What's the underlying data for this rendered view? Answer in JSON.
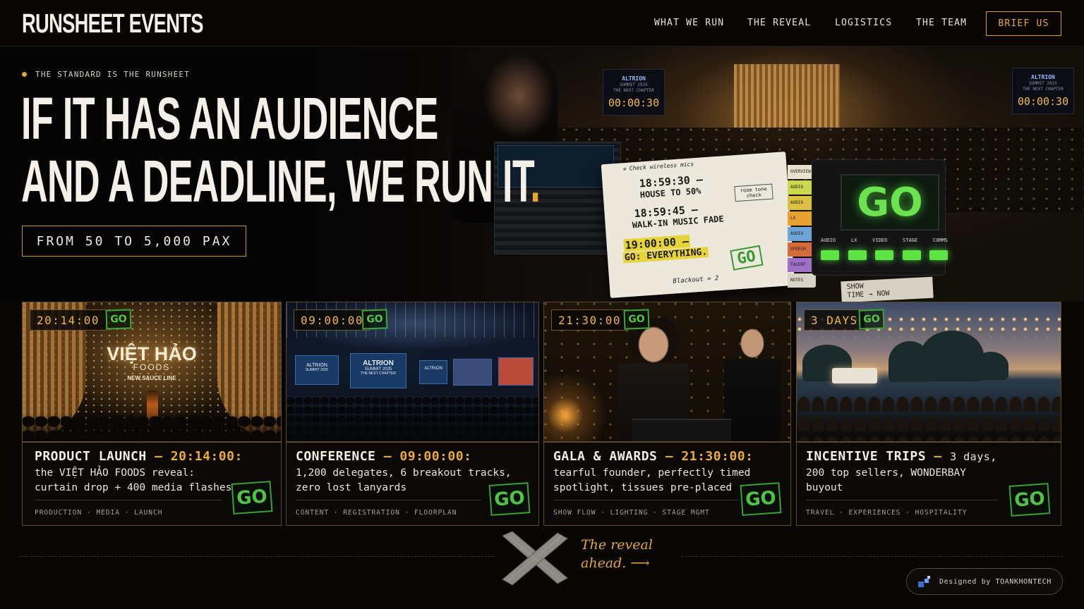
{
  "brand": "RUNSHEET EVENTS",
  "nav": {
    "links": [
      "WHAT WE RUN",
      "THE REVEAL",
      "LOGISTICS",
      "THE TEAM"
    ],
    "cta": "BRIEF US"
  },
  "hero": {
    "eyebrow": "THE STANDARD IS THE RUNSHEET",
    "headline_line1": "IF IT HAS AN AUDIENCE",
    "headline_line2": "AND A DEADLINE, WE RUN IT",
    "headline_dot": ".",
    "pax": "FROM 50 TO 5,000 PAX",
    "monitors": [
      {
        "brand": "ALTRION",
        "sub1": "SUMMIT 2025",
        "sub2": "THE NEXT CHAPTER",
        "time": "00:00:30"
      },
      {
        "brand": "ALTRION",
        "sub1": "SUMMIT 2025",
        "sub2": "THE NEXT CHAPTER",
        "time": "00:00:30"
      }
    ],
    "runsheet": {
      "note_top": "✲ Check wireless mics",
      "line1_time": "18:59:30 —",
      "line1_text": "HOUSE TO 50%",
      "line2_time": "18:59:45 —",
      "line2_text": "WALK-IN MUSIC FADE",
      "line3_time": "19:00:00 —",
      "line3_text": "GO: EVERYTHING.",
      "sticky": "room tone check",
      "footer_note": "Blackout = 2",
      "stamp": "GO",
      "tabs": [
        "OVERVIEW",
        "AUDIO",
        "AUDIO",
        "LX",
        "AUDIO",
        "SPEECH",
        "TALENT",
        "NOTES"
      ]
    },
    "go_panel": {
      "screen": "GO",
      "labels": [
        "AUDIO",
        "LX",
        "VIDEO",
        "STAGE",
        "COMMS"
      ],
      "card_line1": "SHOW",
      "card_line2": "TIME → NOW"
    }
  },
  "cards": [
    {
      "time": "20:14:00",
      "stamp": "GO",
      "title": "PRODUCT LAUNCH",
      "title_time": "20:14:00:",
      "desc1": "the VIỆT HẢO FOODS reveal:",
      "desc2": "curtain drop + 400 media flashes",
      "tags": "PRODUCTION · MEDIA · LAUNCH",
      "image": {
        "brand": "VIỆT HẢO",
        "sub1": "FOODS",
        "sub2": "NEW SAUCE LINE"
      }
    },
    {
      "time": "09:00:00",
      "stamp": "GO",
      "title": "CONFERENCE",
      "title_time": "09:00:00:",
      "desc1": "1,200 delegates, 6 breakout tracks,",
      "desc2": "zero lost lanyards",
      "tags": "CONTENT · REGISTRATION · FLOORPLAN",
      "image": {
        "brand": "ALTRION",
        "sub1": "SUMMIT 2025",
        "sub2": "THE NEXT CHAPTER"
      }
    },
    {
      "time": "21:30:00",
      "stamp": "GO",
      "title": "GALA & AWARDS",
      "title_time": "21:30:00:",
      "desc1": "tearful founder, perfectly timed",
      "desc2": "spotlight, tissues pre-placed",
      "tags": "SHOW FLOW · LIGHTING · STAGE MGMT"
    },
    {
      "time": "3 DAYS",
      "stamp": "GO",
      "title": "INCENTIVE TRIPS",
      "title_time": "",
      "desc1_tail": "3 days,",
      "desc1": "200 top sellers, WONDERBAY",
      "desc2": "buyout",
      "tags": "TRAVEL · EXPERIENCES · HOSPITALITY"
    }
  ],
  "footer": {
    "reveal_line1": "The reveal",
    "reveal_line2": "ahead. ⟶",
    "credit": "Designed by TOANKHONTECH"
  },
  "colors": {
    "accent": "#e5a62f",
    "go_green": "#4fc444",
    "background": "#070605"
  }
}
